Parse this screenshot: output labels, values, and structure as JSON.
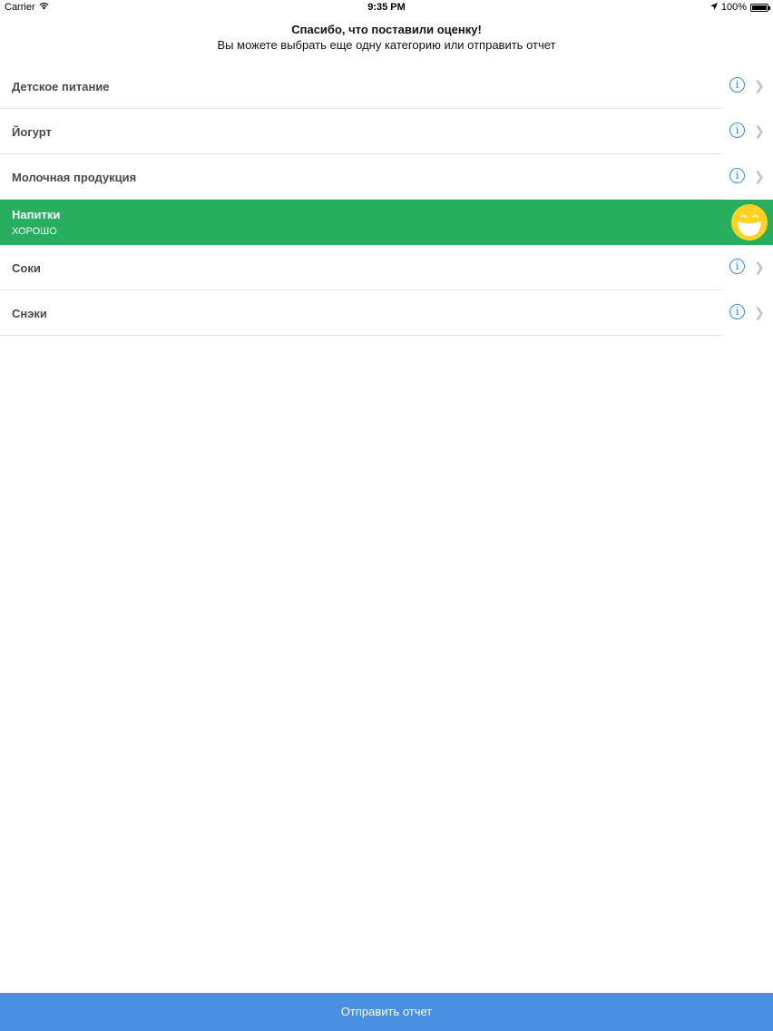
{
  "status_bar": {
    "carrier": "Carrier",
    "time": "9:35 PM",
    "battery": "100%"
  },
  "header": {
    "title": "Спасибо, что поставили оценку!",
    "subtitle": "Вы можете выбрать еще одну категорию или отправить отчет"
  },
  "categories": [
    {
      "label": "Детское питание"
    },
    {
      "label": "Йогурт"
    },
    {
      "label": "Молочная продукция"
    },
    {
      "label": "Напитки",
      "rating": "ХОРОШО"
    },
    {
      "label": "Соки"
    },
    {
      "label": "Снэки"
    }
  ],
  "colors": {
    "selected_row": "#27ae5e",
    "info_icon": "#3a8fdc",
    "submit_bar": "#4a90e2",
    "smiley": "#ffd21f"
  },
  "submit_button": {
    "label": "Отправить отчет"
  }
}
